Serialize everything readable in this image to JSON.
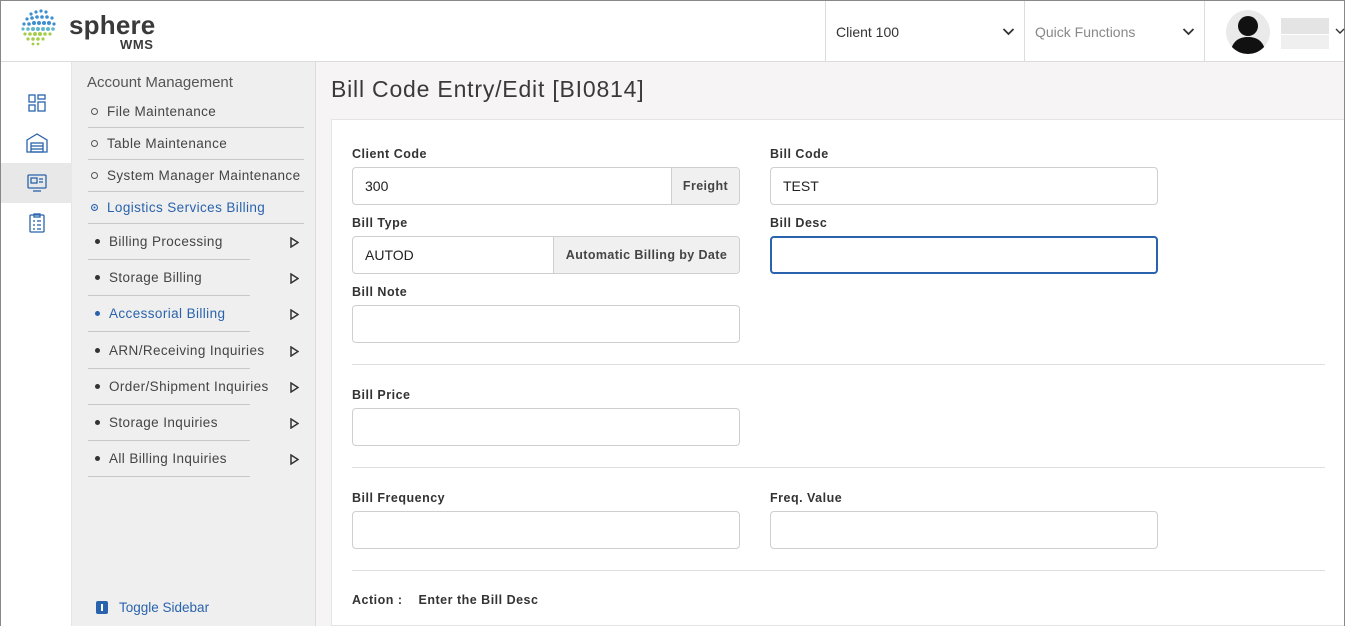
{
  "app": {
    "logo_text": "sphere",
    "logo_sub": "WMS",
    "brand_blue": "#2a63ad",
    "globe_icon": "globe-dots-icon"
  },
  "header": {
    "client_select": "Client 100",
    "quick_functions_placeholder": "Quick Functions",
    "user_avatar_icon": "user-silhouette-icon"
  },
  "rail": {
    "icons": [
      "dashboard-grid-icon",
      "warehouse-icon",
      "billing-icon",
      "checklist-icon"
    ],
    "active_index": 2
  },
  "sidebar": {
    "title": "Account Management",
    "items": [
      {
        "label": "File Maintenance"
      },
      {
        "label": "Table Maintenance"
      },
      {
        "label": "System Manager Maintenance"
      },
      {
        "label": "Logistics Services Billing",
        "active": true
      }
    ],
    "subitems": [
      {
        "label": "Billing Processing"
      },
      {
        "label": "Storage Billing"
      },
      {
        "label": "Accessorial Billing",
        "active": true
      },
      {
        "label": "ARN/Receiving Inquiries"
      },
      {
        "label": "Order/Shipment Inquiries"
      },
      {
        "label": "Storage Inquiries"
      },
      {
        "label": "All Billing Inquiries"
      }
    ],
    "toggle_label": "Toggle Sidebar"
  },
  "page": {
    "title": "Bill Code Entry/Edit [BI0814]"
  },
  "form": {
    "client_code": {
      "label": "Client Code",
      "value": "300",
      "addon": "Freight"
    },
    "bill_code": {
      "label": "Bill Code",
      "value": "TEST"
    },
    "bill_type": {
      "label": "Bill Type",
      "value": "AUTOD",
      "addon": "Automatic Billing by Date"
    },
    "bill_desc": {
      "label": "Bill Desc",
      "value": ""
    },
    "bill_note": {
      "label": "Bill Note",
      "value": ""
    },
    "bill_price": {
      "label": "Bill Price",
      "value": ""
    },
    "bill_frequency": {
      "label": "Bill Frequency",
      "value": ""
    },
    "freq_value": {
      "label": "Freq. Value",
      "value": ""
    }
  },
  "action": {
    "label": "Action :",
    "message": "Enter the Bill Desc"
  }
}
